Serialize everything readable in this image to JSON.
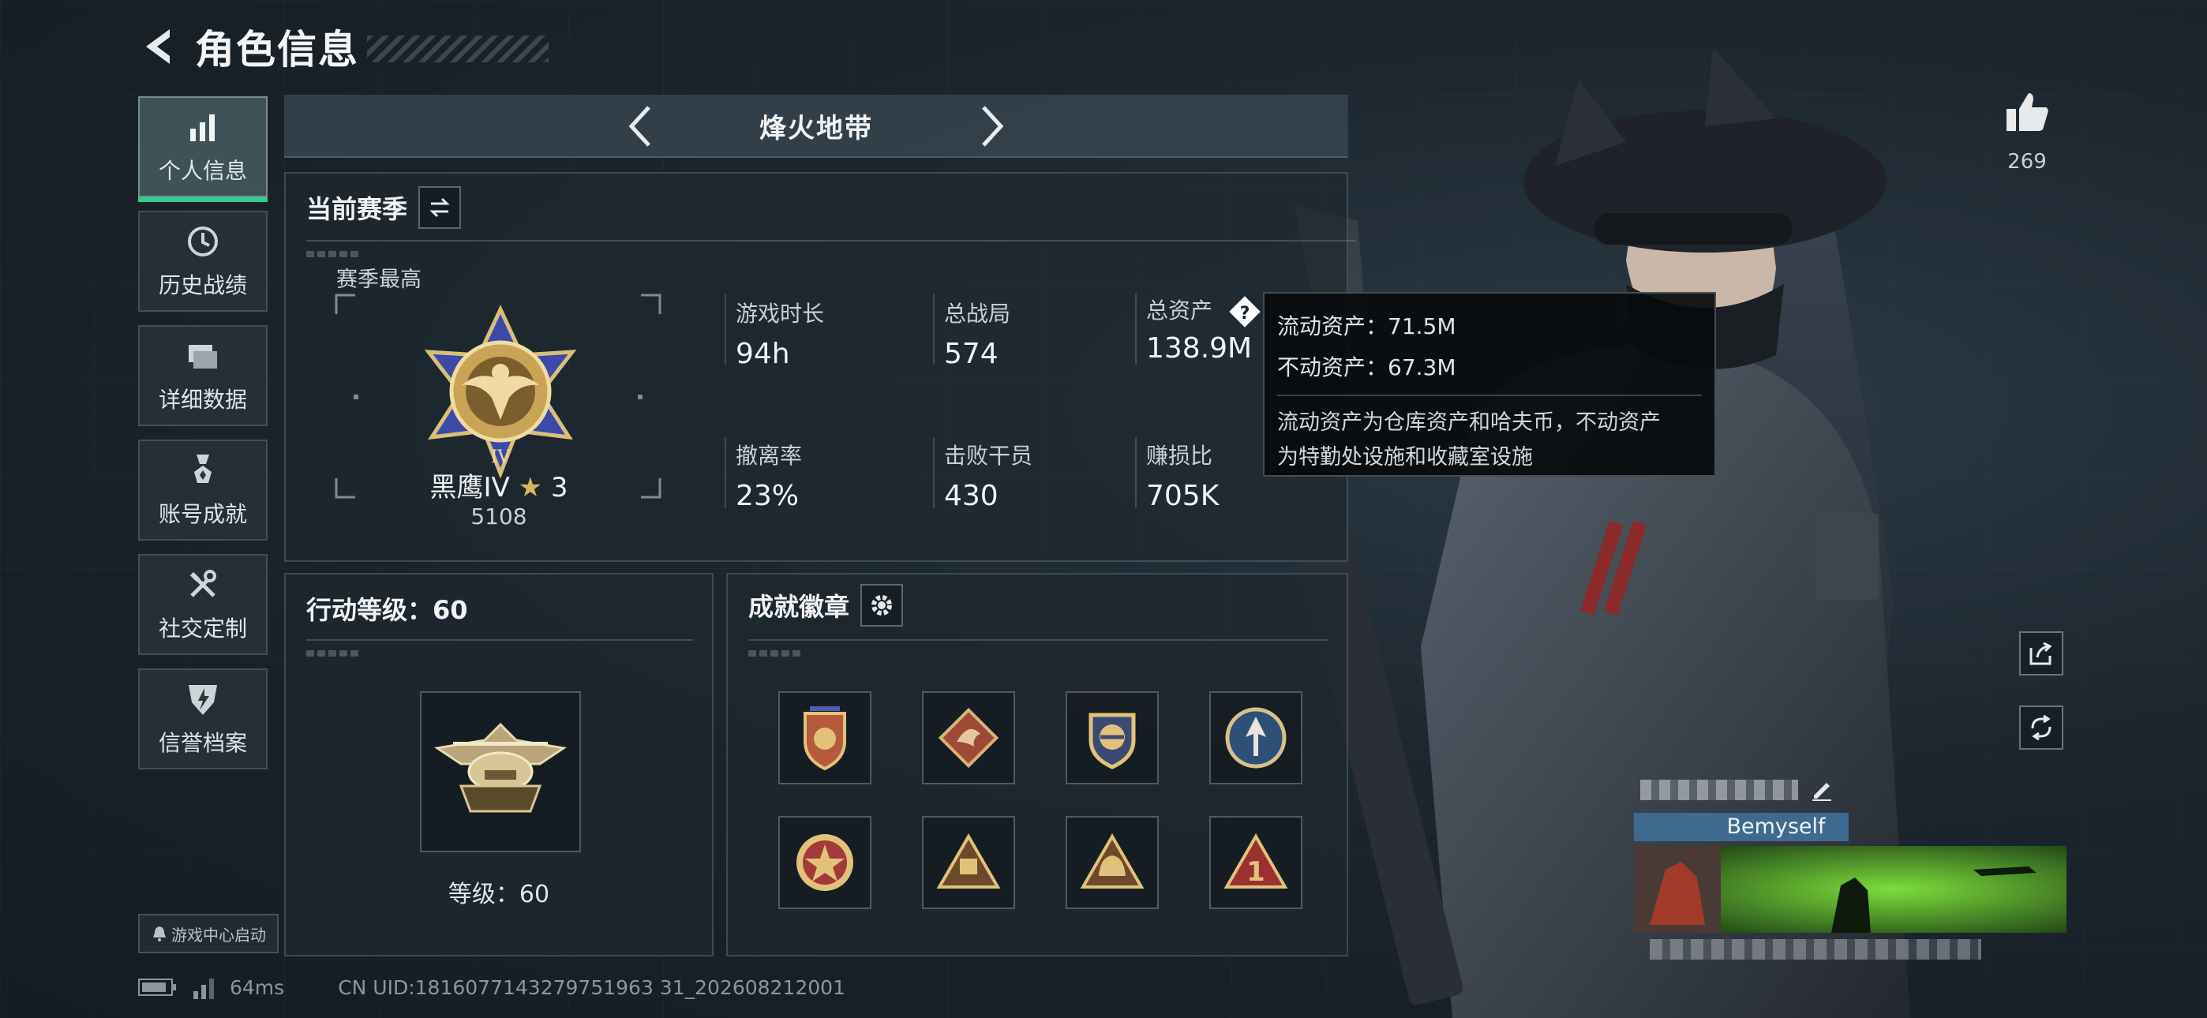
{
  "header": {
    "title": "角色信息"
  },
  "nav": {
    "items": [
      {
        "label": "个人信息",
        "icon": "bar-chart-icon",
        "active": true
      },
      {
        "label": "历史战绩",
        "icon": "history-icon"
      },
      {
        "label": "详细数据",
        "icon": "folder-icon"
      },
      {
        "label": "账号成就",
        "icon": "medal-icon"
      },
      {
        "label": "社交定制",
        "icon": "tools-icon"
      },
      {
        "label": "信誉档案",
        "icon": "shield-bolt-icon"
      }
    ],
    "game_center": "游戏中心启动"
  },
  "mode": {
    "title": "烽火地带"
  },
  "season": {
    "title": "当前赛季",
    "best_label": "赛季最高",
    "rank_name": "黑鹰IV",
    "rank_stars": "3",
    "rank_score": "5108",
    "stats": [
      {
        "label": "游戏时长",
        "value": "94h"
      },
      {
        "label": "总战局",
        "value": "574"
      },
      {
        "label": "总资产",
        "value": "138.9M"
      },
      {
        "label": "撤离率",
        "value": "23%"
      },
      {
        "label": "击败干员",
        "value": "430"
      },
      {
        "label": "赚损比",
        "value": "705K"
      }
    ]
  },
  "tooltip": {
    "liquid": "流动资产：71.5M",
    "fixed": "不动资产：67.3M",
    "desc_line1": "流动资产为仓库资产和哈夫币，不动资产",
    "desc_line2": "为特勤处设施和收藏室设施"
  },
  "level": {
    "title": "行动等级：60",
    "label": "等级：60"
  },
  "badges": {
    "title": "成就徽章",
    "items": [
      "badge-1",
      "badge-2",
      "badge-3",
      "badge-4",
      "badge-5",
      "badge-6",
      "badge-7",
      "badge-8"
    ]
  },
  "profile": {
    "likes": "269",
    "tag": "Bemyself"
  },
  "status": {
    "ping": "64ms",
    "uid": "CN UID:1816077143279751963 31_202608212001"
  },
  "colors": {
    "accent": "#2ed08a",
    "gold": "#d6b85a",
    "tag": "#3d6a8e"
  }
}
